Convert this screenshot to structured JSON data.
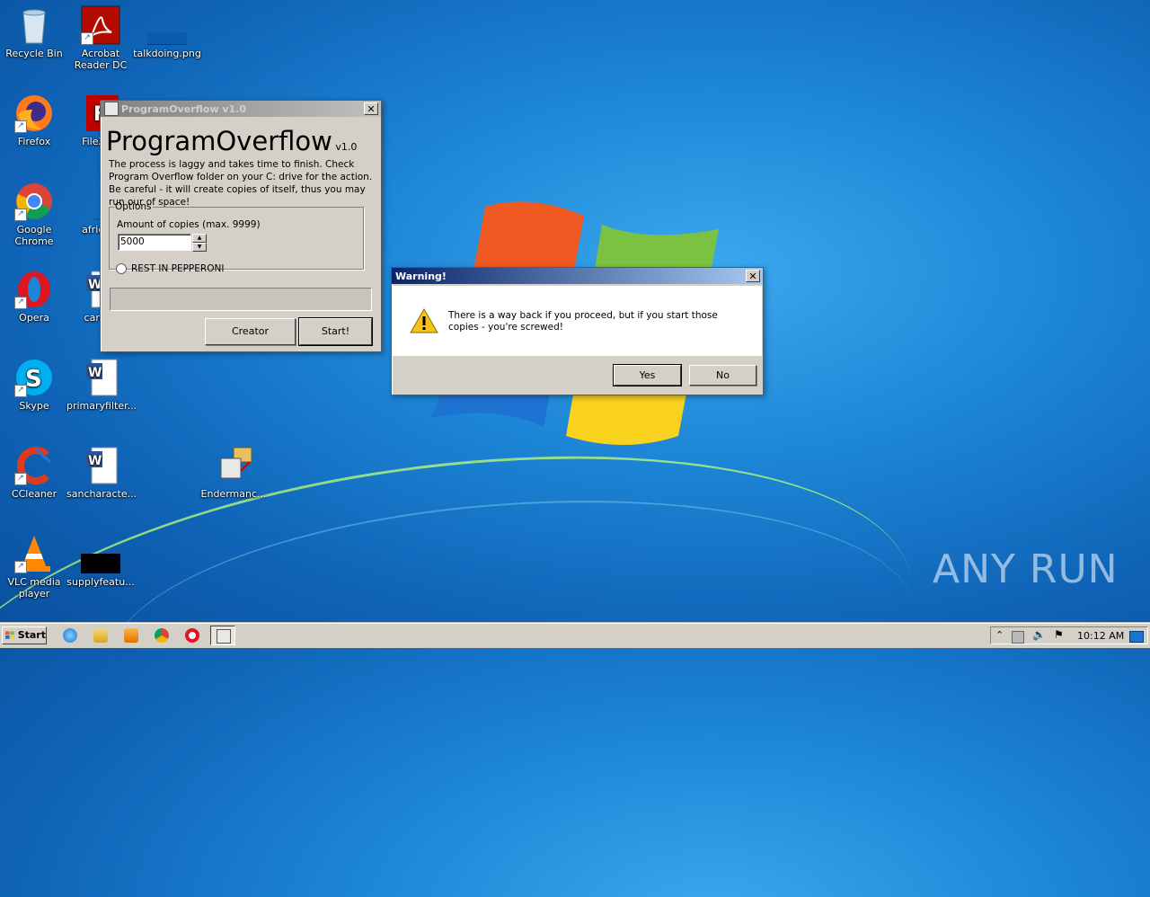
{
  "desktop": {
    "icons": [
      {
        "label": "Recycle Bin"
      },
      {
        "label": "Acrobat Reader DC"
      },
      {
        "label": "talkdoing.png"
      },
      {
        "label": "Firefox"
      },
      {
        "label": "FileZilla"
      },
      {
        "label": "Google Chrome"
      },
      {
        "label": "africam"
      },
      {
        "label": "Opera"
      },
      {
        "label": "carolin"
      },
      {
        "label": "Skype"
      },
      {
        "label": "primaryfilter..."
      },
      {
        "label": "CCleaner"
      },
      {
        "label": "sancharacte..."
      },
      {
        "label": "Endermanc..."
      },
      {
        "label": "VLC media player"
      },
      {
        "label": "supplyfeatu..."
      }
    ],
    "watermark": "ANY RUN"
  },
  "program_window": {
    "title": "ProgramOverflow v1.0",
    "heading": "ProgramOverflow",
    "version": "v1.0",
    "description": "The process is laggy and takes time to finish. Check Program Overflow folder on your C: drive for the action. Be careful - it will create copies of itself, thus you may run our of space!",
    "options_label": "Options",
    "copies_label": "Amount of copies (max. 9999)",
    "copies_value": "5000",
    "radio_label": "REST IN PEPPERONI",
    "creator_button": "Creator",
    "start_button": "Start!"
  },
  "warning_dialog": {
    "title": "Warning!",
    "message": "There is a way back if you proceed, but if you start those copies - you're screwed!",
    "yes_button": "Yes",
    "no_button": "No"
  },
  "taskbar": {
    "start_label": "Start",
    "clock": "10:12 AM"
  },
  "colors": {
    "active_title_start": "#0a246a",
    "active_title_end": "#a6caf0",
    "inactive_title_start": "#808080",
    "inactive_title_end": "#c0c0c0",
    "window_face": "#d4d0c8"
  }
}
